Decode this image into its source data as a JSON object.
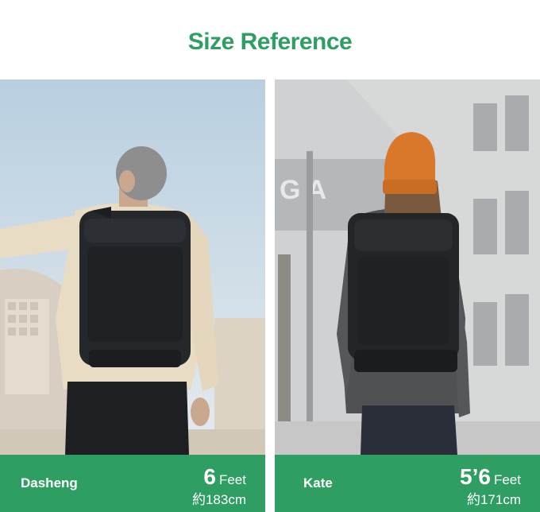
{
  "title": "Size Reference",
  "people": [
    {
      "name": "Dasheng",
      "height_num": "6",
      "height_unit": "Feet",
      "height_metric": "約183cm"
    },
    {
      "name": "Kate",
      "height_num": "5’6",
      "height_unit": "Feet",
      "height_metric": "約171cm"
    }
  ],
  "colors": {
    "accent": "#2e9e63",
    "background": "#ffffff"
  }
}
